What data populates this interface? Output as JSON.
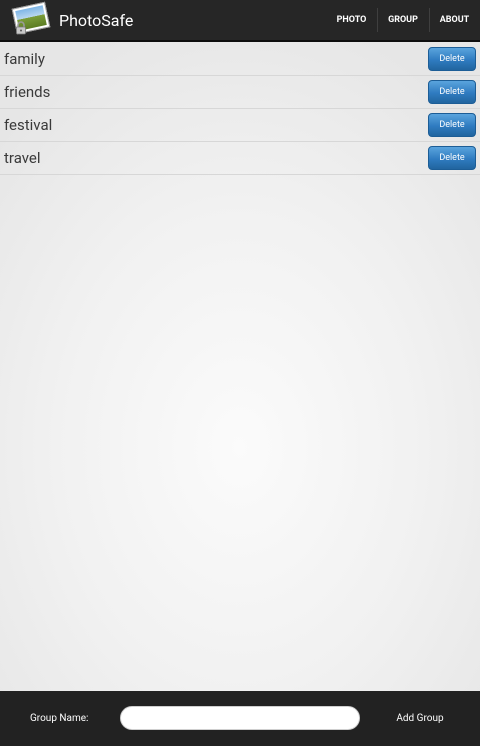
{
  "app": {
    "title": "PhotoSafe",
    "icon": "photo-lock-icon"
  },
  "tabs": [
    {
      "label": "PHOTO"
    },
    {
      "label": "GROUP"
    },
    {
      "label": "ABOUT"
    }
  ],
  "groups": [
    {
      "name": "family",
      "action": "Delete"
    },
    {
      "name": "friends",
      "action": "Delete"
    },
    {
      "name": "festival",
      "action": "Delete"
    },
    {
      "name": "travel",
      "action": "Delete"
    }
  ],
  "footer": {
    "label": "Group Name:",
    "input_value": "",
    "button_label": "Add Group"
  },
  "colors": {
    "action_bar": "#262626",
    "button_blue": "#2f7bc0",
    "footer": "#222222"
  }
}
